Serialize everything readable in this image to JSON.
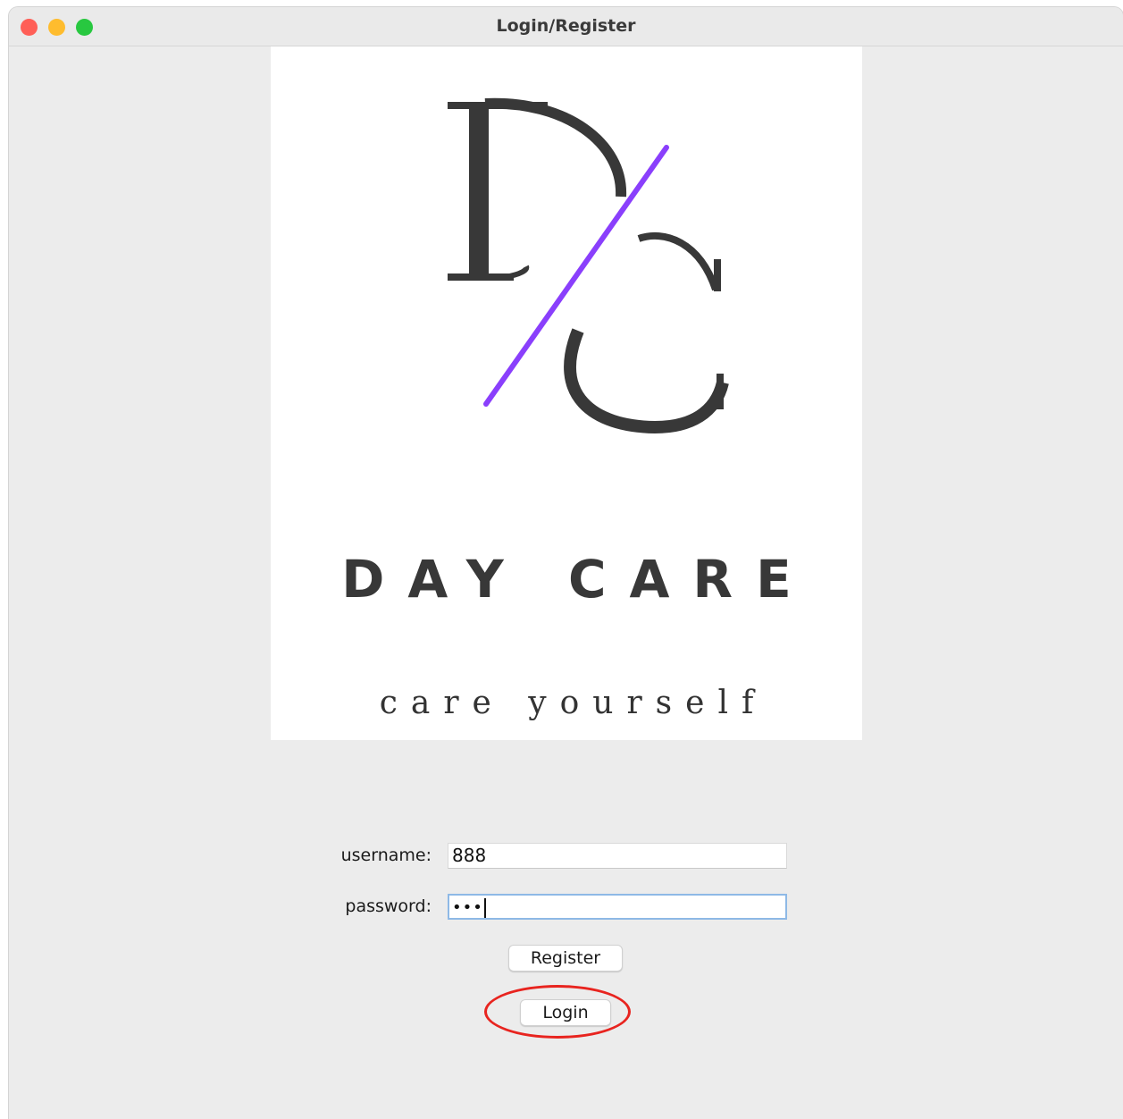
{
  "window": {
    "title": "Login/Register"
  },
  "logo": {
    "monogram": "DC",
    "brand": "DAY CARE",
    "tagline": "care yourself",
    "accent_color": "#8a3ffc",
    "ink_color": "#383838"
  },
  "form": {
    "username_label": "username:",
    "username_value": "888",
    "password_label": "password:",
    "password_masked": "•••"
  },
  "buttons": {
    "register": "Register",
    "login": "Login"
  },
  "annotation": {
    "highlight_color": "#e8241f",
    "highlighted": "login-button"
  }
}
